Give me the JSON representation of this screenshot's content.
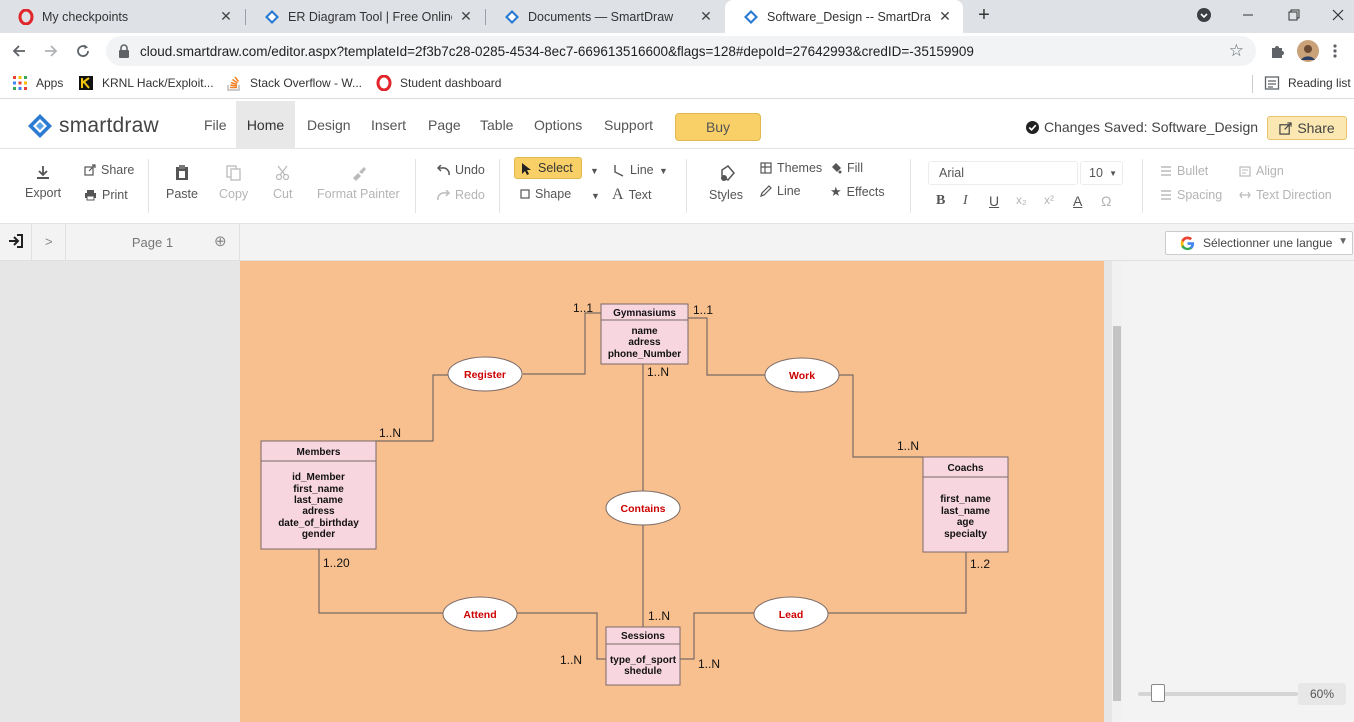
{
  "browser": {
    "tabs": [
      {
        "title": "My checkpoints",
        "icon": "opera-icon"
      },
      {
        "title": "ER Diagram Tool | Free Online Ap",
        "icon": "smartdraw-icon"
      },
      {
        "title": "Documents — SmartDraw",
        "icon": "smartdraw-icon"
      },
      {
        "title": "Software_Design -- SmartDraw",
        "icon": "smartdraw-icon"
      }
    ],
    "new_tab": "+",
    "url": "cloud.smartdraw.com/editor.aspx?templateId=2f3b7c28-0285-4534-8ec7-669613516600&flags=128#depoId=27642993&credID=-35159909",
    "bookmarks": [
      {
        "label": "Apps"
      },
      {
        "label": "KRNL Hack/Exploit..."
      },
      {
        "label": "Stack Overflow - W..."
      },
      {
        "label": "Student dashboard"
      }
    ],
    "reading_list": "Reading list"
  },
  "app": {
    "logo_text": "smartdraw",
    "menu": [
      "File",
      "Home",
      "Design",
      "Insert",
      "Page",
      "Table",
      "Options",
      "Support"
    ],
    "active_menu": "Home",
    "buy_label": "Buy",
    "saved_status": "Changes Saved: Software_Design",
    "share_label": "Share"
  },
  "ribbon": {
    "export": "Export",
    "share": "Share",
    "print": "Print",
    "paste": "Paste",
    "copy": "Copy",
    "cut": "Cut",
    "format_painter": "Format Painter",
    "undo": "Undo",
    "redo": "Redo",
    "select": "Select",
    "shape": "Shape",
    "line": "Line",
    "text": "Text",
    "styles": "Styles",
    "themes": "Themes",
    "line2": "Line",
    "fill": "Fill",
    "effects": "Effects",
    "font": "Arial",
    "font_size": "10",
    "bold": "B",
    "italic": "I",
    "underline": "U",
    "subscript": "x₂",
    "superscript": "x²",
    "font_color": "A",
    "symbol": "Ω",
    "bullet": "Bullet",
    "spacing": "Spacing",
    "align": "Align",
    "text_direction": "Text Direction"
  },
  "pagebar": {
    "expand": ">",
    "page_tab": "Page 1",
    "add_page": "⊕",
    "language": "Sélectionner une langue"
  },
  "zoom": {
    "label": "60%",
    "value_percent": 60
  },
  "diagram": {
    "entities": [
      {
        "id": "gym",
        "title": "Gymnasiums",
        "attributes": [
          "name",
          "adress",
          "phone_Number"
        ]
      },
      {
        "id": "members",
        "title": "Members",
        "attributes": [
          "id_Member",
          "first_name",
          "last_name",
          "adress",
          "date_of_birthday",
          "gender"
        ]
      },
      {
        "id": "coachs",
        "title": "Coachs",
        "attributes": [
          "first_name",
          "last_name",
          "age",
          "specialty"
        ]
      },
      {
        "id": "sessions",
        "title": "Sessions",
        "attributes": [
          "type_of_sport",
          "shedule"
        ]
      }
    ],
    "relationships": [
      {
        "id": "register",
        "label": "Register"
      },
      {
        "id": "work",
        "label": "Work"
      },
      {
        "id": "contains",
        "label": "Contains"
      },
      {
        "id": "attend",
        "label": "Attend"
      },
      {
        "id": "lead",
        "label": "Lead"
      }
    ],
    "cardinalities": {
      "gym_left": "1..1",
      "gym_right": "1..1",
      "gym_bottom": "1..N",
      "members_top": "1..N",
      "members_bottom": "1..20",
      "coachs_top": "1..N",
      "coachs_bottom": "1..2",
      "sessions_top": "1..N",
      "sessions_left": "1..N",
      "sessions_right": "1..N"
    },
    "colors": {
      "canvas": "#f8bf8f",
      "entity_fill": "#f7d6e0",
      "relationship_text": "#cc0000",
      "line": "#7a6a66"
    }
  }
}
